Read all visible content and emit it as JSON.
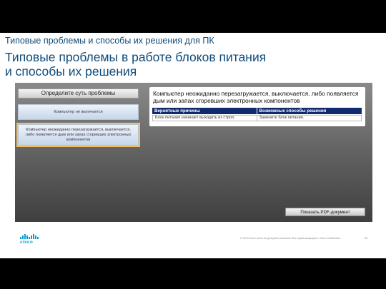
{
  "slide": {
    "subtitle": "Типовые проблемы и способы их решения для ПК",
    "title_line1": "Типовые проблемы в работе блоков питания",
    "title_line2": "и способы их решения"
  },
  "panel": {
    "define_label": "Определите суть проблемы",
    "options": [
      "Компьютер не включается",
      "Компьютер неожиданно перезагружается, выключается, либо появляется дым или запах сгоревших электронных компонентов"
    ],
    "table": {
      "title": "Компьютер неожиданно перезагружается, выключается, либо появляется дым или запах сгоревших электронных компонентов",
      "headers": [
        "Вероятные причины",
        "Возможные способы решения"
      ],
      "rows": [
        [
          "Блок питания начинает выходить из строя.",
          "Замените блок питания."
        ]
      ]
    },
    "pdf_button": "Показать PDF-документ"
  },
  "footer": {
    "logo_text": "cisco",
    "copyright": "© 2013 Cisco и/или ее дочерние компании. Все права защищены. Cisco Confidential",
    "page": "30"
  },
  "colors": {
    "title": "#0f4b7a",
    "table_header": "#102a6e",
    "cisco_blue": "#049fd9",
    "highlight": "#f0c060"
  }
}
